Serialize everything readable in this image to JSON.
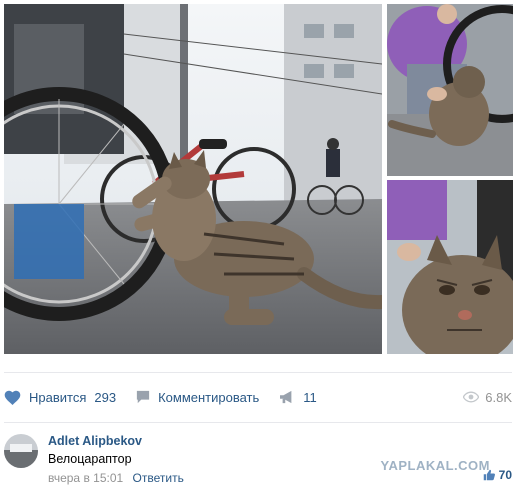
{
  "photos": {
    "main_alt": "",
    "top_alt": "",
    "bottom_alt": ""
  },
  "actions": {
    "like_label": "Нравится",
    "like_count": "293",
    "comment_label": "Комментировать",
    "share_count": "11",
    "views_count": "6.8K",
    "colors": {
      "link": "#2a5885",
      "muted": "#939393",
      "heart": "#5181b8"
    }
  },
  "comment": {
    "author": "Adlet Alipbekov",
    "text": "Велоцараптор",
    "time": "вчера в 15:01",
    "reply_label": "Ответить",
    "like_count": "70",
    "watermark": "YAPLAKAL.COM"
  },
  "icons": [
    "heart-icon",
    "comment-icon",
    "share-megaphone-icon",
    "eye-icon",
    "thumbs-up-icon"
  ]
}
